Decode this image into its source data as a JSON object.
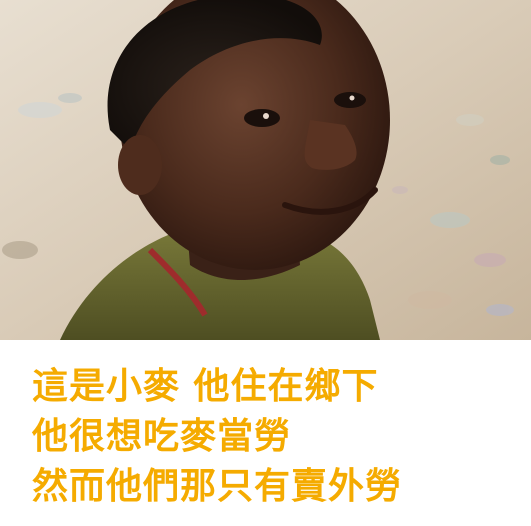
{
  "photo": {
    "subject": "boy-portrait-photo"
  },
  "caption": {
    "color": "#f5ab00",
    "lines": [
      "這是小麥 他住在鄉下",
      "他很想吃麥當勞",
      "然而他們那只有賣外勞"
    ]
  }
}
